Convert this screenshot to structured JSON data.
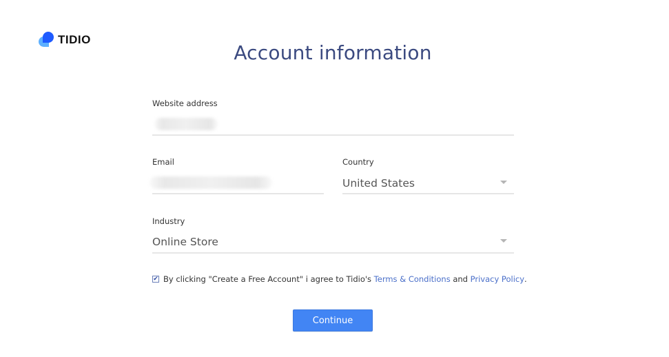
{
  "brand": {
    "name": "TIDIO",
    "primary_color": "#1e5bff",
    "secondary_color": "#4fa9ff"
  },
  "page": {
    "title": "Account information"
  },
  "form": {
    "website": {
      "label": "Website address",
      "value": ""
    },
    "email": {
      "label": "Email",
      "value": ""
    },
    "country": {
      "label": "Country",
      "value": "United States"
    },
    "industry": {
      "label": "Industry",
      "value": "Online Store"
    }
  },
  "agreement": {
    "checked": true,
    "text_prefix": "By clicking \"Create a Free Account\" i agree to Tidio's ",
    "terms_link": "Terms & Conditions",
    "text_and": " and ",
    "privacy_link": "Privacy Policy",
    "text_suffix": ".",
    "checkmark": "✔"
  },
  "actions": {
    "continue_label": "Continue",
    "button_color": "#4285f4"
  }
}
